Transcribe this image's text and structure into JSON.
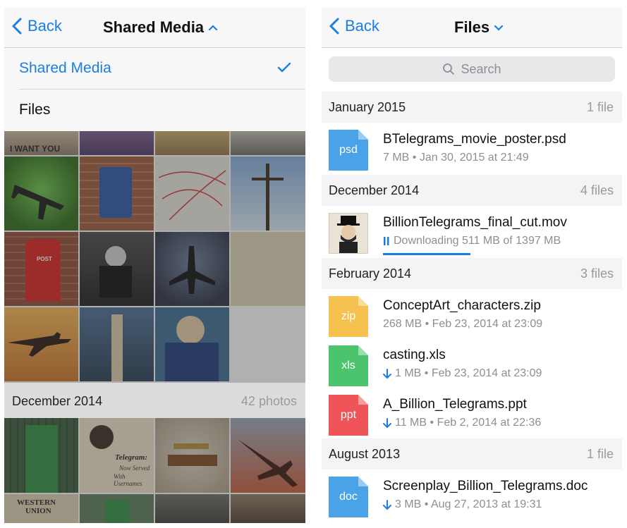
{
  "left": {
    "nav": {
      "back": "Back",
      "title": "Shared Media"
    },
    "menu": [
      {
        "label": "Shared Media",
        "selected": true
      },
      {
        "label": "Files",
        "selected": false
      }
    ],
    "sections": [
      {
        "title": "December 2014",
        "count": "42 photos"
      }
    ],
    "photo_captions": {
      "top_left": "I WANT YOU",
      "post_box": "POST",
      "telegram": "Telegram:",
      "telegram_sub1": "Now Served",
      "telegram_sub2": "With Usernames",
      "western_union1": "WESTERN",
      "western_union2": "UNION"
    }
  },
  "right": {
    "nav": {
      "back": "Back",
      "title": "Files"
    },
    "search": {
      "placeholder": "Search"
    },
    "sections": [
      {
        "title": "January 2015",
        "count": "1 file",
        "files": [
          {
            "name": "BTelegrams_movie_poster.psd",
            "meta": "7 MB • Jan 30, 2015 at 21:49",
            "ext": "psd",
            "color": "#4aa3e6",
            "download": false
          }
        ]
      },
      {
        "title": "December 2014",
        "count": "4 files",
        "files": [
          {
            "name": "BillionTelegrams_final_cut.mov",
            "meta": "Downloading 511 MB of 1397 MB",
            "ext": "",
            "color": "",
            "download": false,
            "progress": 0.366
          }
        ]
      },
      {
        "title": "February 2014",
        "count": "3 files",
        "files": [
          {
            "name": "ConceptArt_characters.zip",
            "meta": "268 MB • Feb 23, 2014 at 23:09",
            "ext": "zip",
            "color": "#f5c250",
            "download": false
          },
          {
            "name": "casting.xls",
            "meta": "1 MB • Feb 23, 2014 at 23:09",
            "ext": "xls",
            "color": "#4cc46e",
            "download": true
          },
          {
            "name": "A_Billion_Telegrams.ppt",
            "meta": "11 MB • Feb 2, 2014 at 22:36",
            "ext": "ppt",
            "color": "#ef5558",
            "download": true
          }
        ]
      },
      {
        "title": "August 2013",
        "count": "1 file",
        "files": [
          {
            "name": "Screenplay_Billion_Telegrams.doc",
            "meta": "3 MB • Aug 27, 2013 at 19:31",
            "ext": "doc",
            "color": "#4aa3e6",
            "download": true
          }
        ]
      }
    ]
  },
  "colors": {
    "accent": "#1a7fe0",
    "psd": "#4aa3e6",
    "zip": "#f5c250",
    "xls": "#4cc46e",
    "ppt": "#ef5558",
    "doc": "#4aa3e6"
  }
}
